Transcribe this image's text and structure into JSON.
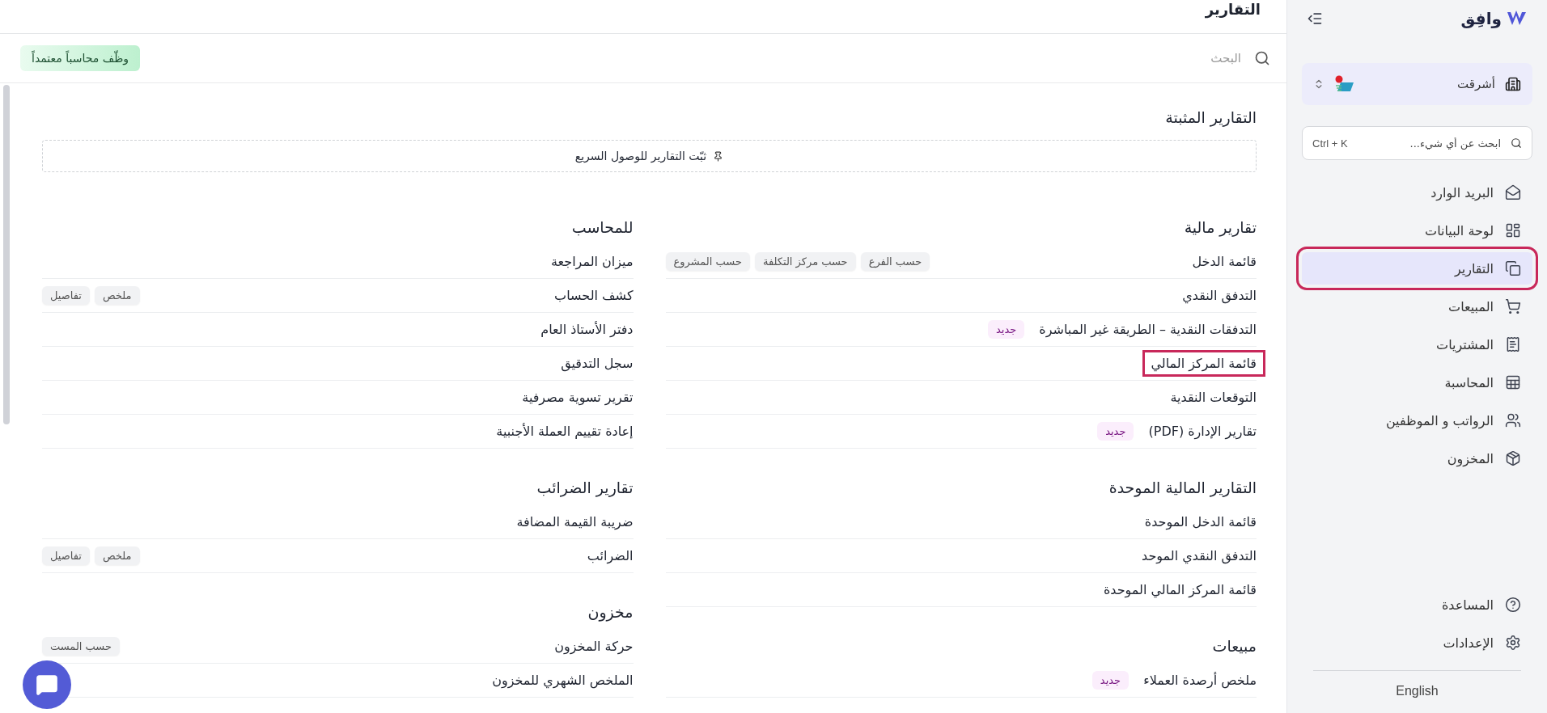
{
  "sidebar": {
    "logo_text": "وافِق",
    "organization": {
      "name": "أشرقت"
    },
    "search": {
      "placeholder": "ابحث عن أي شيء...",
      "shortcut": "Ctrl + K"
    },
    "items": [
      {
        "label": "البريد الوارد",
        "kind": "inbox",
        "selected": false,
        "highlighted": false
      },
      {
        "label": "لوحة البيانات",
        "kind": "dashboard",
        "selected": false,
        "highlighted": false
      },
      {
        "label": "التقارير",
        "kind": "reports",
        "selected": true,
        "highlighted": true
      },
      {
        "label": "المبيعات",
        "kind": "sales",
        "selected": false,
        "highlighted": false
      },
      {
        "label": "المشتريات",
        "kind": "purchases",
        "selected": false,
        "highlighted": false
      },
      {
        "label": "المحاسبة",
        "kind": "accounting",
        "selected": false,
        "highlighted": false
      },
      {
        "label": "الرواتب و الموظفين",
        "kind": "payroll",
        "selected": false,
        "highlighted": false
      },
      {
        "label": "المخزون",
        "kind": "inventory",
        "selected": false,
        "highlighted": false
      }
    ],
    "footer_items": [
      {
        "label": "المساعدة",
        "kind": "help"
      },
      {
        "label": "الإعدادات",
        "kind": "settings"
      }
    ],
    "language": "English"
  },
  "header": {
    "title": "التقارير"
  },
  "toolbar": {
    "search": {
      "placeholder": "البحث"
    },
    "cta": "وظّف محاسباً معتمداً"
  },
  "pinned": {
    "title": "التقارير المثبتة",
    "hint": "ثبّت التقارير للوصول السريع"
  },
  "columns": [
    [
      {
        "title": "تقارير مالية",
        "rows": [
          {
            "label": "قائمة الدخل",
            "highlighted": false,
            "tags": [
              {
                "label": "حسب الفرع",
                "kind": "filter"
              },
              {
                "label": "حسب مركز التكلفة",
                "kind": "filter"
              },
              {
                "label": "حسب المشروع",
                "kind": "filter"
              }
            ]
          },
          {
            "label": "التدفق النقدي",
            "highlighted": false,
            "tags": []
          },
          {
            "label": "التدفقات النقدية – الطريقة غير المباشرة",
            "highlighted": false,
            "tags": [
              {
                "label": "جديد",
                "kind": "new"
              }
            ]
          },
          {
            "label": "قائمة المركز المالي",
            "highlighted": true,
            "tags": []
          },
          {
            "label": "التوقعات النقدية",
            "highlighted": false,
            "tags": []
          },
          {
            "label": "تقارير الإدارة (PDF)",
            "highlighted": false,
            "tags": [
              {
                "label": "جديد",
                "kind": "new"
              }
            ]
          }
        ]
      },
      {
        "title": "التقارير المالية الموحدة",
        "rows": [
          {
            "label": "قائمة الدخل الموحدة",
            "highlighted": false,
            "tags": []
          },
          {
            "label": "التدفق النقدي الموحد",
            "highlighted": false,
            "tags": []
          },
          {
            "label": "قائمة المركز المالي الموحدة",
            "highlighted": false,
            "tags": []
          }
        ]
      },
      {
        "title": "مبيعات",
        "rows": [
          {
            "label": "ملخص أرصدة العملاء",
            "highlighted": false,
            "tags": [
              {
                "label": "جديد",
                "kind": "new"
              }
            ]
          }
        ]
      }
    ],
    [
      {
        "title": "للمحاسب",
        "rows": [
          {
            "label": "ميزان المراجعة",
            "highlighted": false,
            "tags": []
          },
          {
            "label": "كشف الحساب",
            "highlighted": false,
            "tags": [
              {
                "label": "ملخص",
                "kind": "filter"
              },
              {
                "label": "تفاصيل",
                "kind": "filter"
              }
            ]
          },
          {
            "label": "دفتر الأستاذ العام",
            "highlighted": false,
            "tags": []
          },
          {
            "label": "سجل التدقيق",
            "highlighted": false,
            "tags": []
          },
          {
            "label": "تقرير تسوية مصرفية",
            "highlighted": false,
            "tags": []
          },
          {
            "label": "إعادة تقييم العملة الأجنبية",
            "highlighted": false,
            "tags": []
          }
        ]
      },
      {
        "title": "تقارير الضرائب",
        "rows": [
          {
            "label": "ضريبة القيمة المضافة",
            "highlighted": false,
            "tags": []
          },
          {
            "label": "الضرائب",
            "highlighted": false,
            "tags": [
              {
                "label": "ملخص",
                "kind": "filter"
              },
              {
                "label": "تفاصيل",
                "kind": "filter"
              }
            ]
          }
        ]
      },
      {
        "title": "مخزون",
        "rows": [
          {
            "label": "حركة المخزون",
            "highlighted": false,
            "tags": [
              {
                "label": "حسب المست",
                "kind": "filter"
              }
            ]
          },
          {
            "label": "الملخص الشهري للمخزون",
            "highlighted": false,
            "tags": []
          }
        ]
      }
    ]
  ]
}
